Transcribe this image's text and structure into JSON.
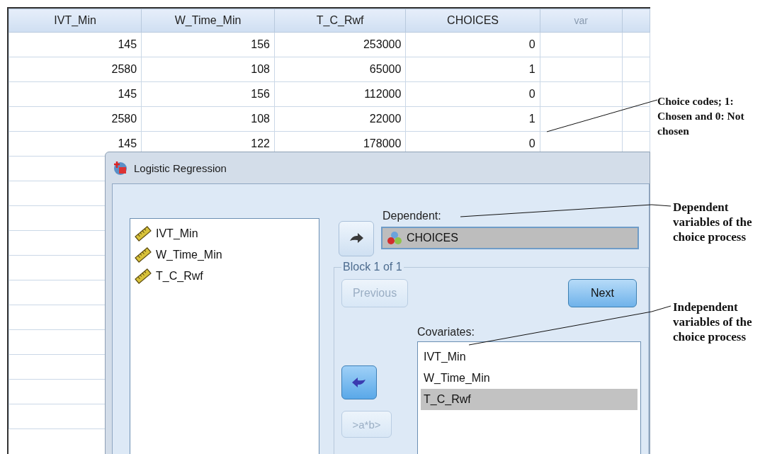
{
  "table": {
    "columns": [
      "IVT_Min",
      "W_Time_Min",
      "T_C_Rwf",
      "CHOICES",
      "var"
    ],
    "rows": [
      [
        "145",
        "156",
        "253000",
        "0"
      ],
      [
        "2580",
        "108",
        "65000",
        "1"
      ],
      [
        "145",
        "156",
        "112000",
        "0"
      ],
      [
        "2580",
        "108",
        "22000",
        "1"
      ],
      [
        "145",
        "122",
        "178000",
        "0"
      ]
    ]
  },
  "dialog": {
    "title": "Logistic Regression",
    "source_variables": [
      {
        "label": "IVT_Min",
        "kind": "scale"
      },
      {
        "label": "W_Time_Min",
        "kind": "scale"
      },
      {
        "label": "T_C_Rwf",
        "kind": "scale"
      }
    ],
    "dependent": {
      "label": "Dependent:",
      "value": "CHOICES",
      "kind": "nominal"
    },
    "block": {
      "label": "Block 1 of 1",
      "previous": {
        "label": "Previous",
        "disabled": true
      },
      "next": {
        "label": "Next",
        "disabled": false
      }
    },
    "covariates": {
      "label": "Covariates:",
      "items": [
        {
          "label": "IVT_Min",
          "selected": false
        },
        {
          "label": "W_Time_Min",
          "selected": false
        },
        {
          "label": "T_C_Rwf",
          "selected": true
        }
      ]
    },
    "interaction_button": {
      "label": ">a*b>",
      "disabled": true
    }
  },
  "annotations": [
    {
      "text": "Choice codes; 1: Chosen and 0: Not chosen"
    },
    {
      "text": "Dependent variables of the choice process"
    },
    {
      "text": "Independent variables of the choice process"
    }
  ]
}
